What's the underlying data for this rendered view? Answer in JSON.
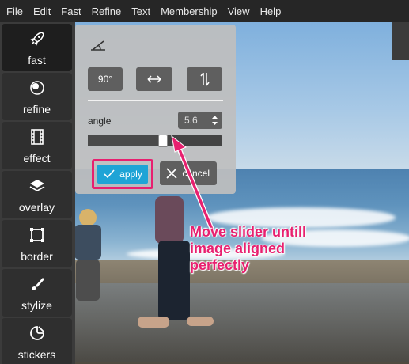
{
  "menu": [
    "File",
    "Edit",
    "Fast",
    "Refine",
    "Text",
    "Membership",
    "View",
    "Help"
  ],
  "tools": [
    {
      "label": "fast",
      "icon": "rocket-icon",
      "active": true
    },
    {
      "label": "refine",
      "icon": "refine-icon",
      "active": false
    },
    {
      "label": "effect",
      "icon": "film-icon",
      "active": false
    },
    {
      "label": "overlay",
      "icon": "layers-icon",
      "active": false
    },
    {
      "label": "border",
      "icon": "border-frame-icon",
      "active": false
    },
    {
      "label": "stylize",
      "icon": "brush-icon",
      "active": false
    },
    {
      "label": "stickers",
      "icon": "sticker-icon",
      "active": false
    }
  ],
  "panel": {
    "header_icon": "straighten-angle-icon",
    "rotate90_label": "90°",
    "flip_horizontal_icon": "flip-horizontal-icon",
    "flip_vertical_icon": "flip-vertical-icon",
    "angle_label": "angle",
    "angle_value": "5.6",
    "slider_fraction": 0.56,
    "apply_label": "apply",
    "cancel_label": "cancel"
  },
  "annotation": {
    "lines": [
      "Move slider untill",
      "image aligned",
      "perfectly"
    ],
    "color": "#e8206f"
  },
  "colors": {
    "accent": "#1ea4d6",
    "highlight": "#e8206f"
  }
}
